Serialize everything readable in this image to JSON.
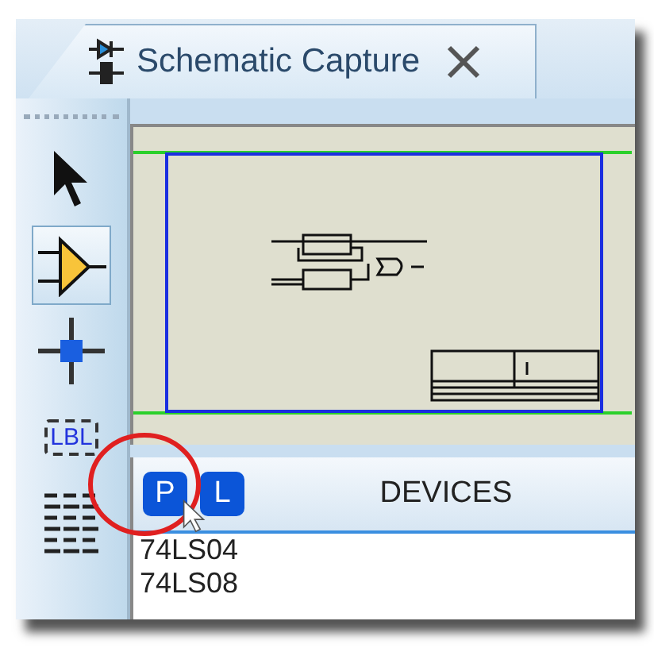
{
  "tab": {
    "title": "Schematic Capture",
    "selected": true
  },
  "tools": [
    {
      "kind": "pointer",
      "selected": false
    },
    {
      "kind": "component",
      "selected": true
    },
    {
      "kind": "junction",
      "selected": false
    },
    {
      "kind": "label",
      "text": "LBL",
      "selected": false
    },
    {
      "kind": "text",
      "selected": false
    }
  ],
  "devices": {
    "buttons": [
      "P",
      "L"
    ],
    "title": "DEVICES",
    "items": [
      "74LS04",
      "74LS08"
    ]
  }
}
